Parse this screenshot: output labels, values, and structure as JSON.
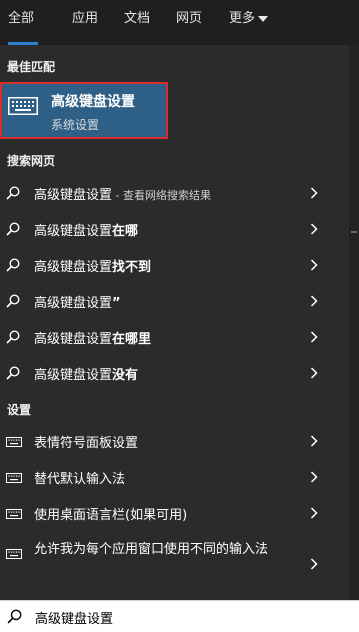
{
  "tabs": [
    {
      "label": "全部",
      "active": true
    },
    {
      "label": "应用"
    },
    {
      "label": "文档"
    },
    {
      "label": "网页"
    },
    {
      "label": "更多"
    }
  ],
  "best_match": {
    "header": "最佳匹配",
    "title": "高级键盘设置",
    "subtitle": "系统设置",
    "icon": "keyboard-icon"
  },
  "web": {
    "header": "搜索网页",
    "items": [
      {
        "prefix": "高级键盘设置",
        "bold": "",
        "suffix": " - 查看网络搜索结果"
      },
      {
        "prefix": "高级键盘设置",
        "bold": "在哪",
        "suffix": ""
      },
      {
        "prefix": "高级键盘设置",
        "bold": "找不到",
        "suffix": ""
      },
      {
        "prefix": "高级键盘设置",
        "bold": "”",
        "suffix": ""
      },
      {
        "prefix": "高级键盘设置",
        "bold": "在哪里",
        "suffix": ""
      },
      {
        "prefix": "高级键盘设置",
        "bold": "没有",
        "suffix": ""
      }
    ]
  },
  "settings": {
    "header": "设置",
    "items": [
      {
        "label": "表情符号面板设置"
      },
      {
        "label": "替代默认输入法"
      },
      {
        "label": "使用桌面语言栏(如果可用)"
      },
      {
        "label": "允许我为每个应用窗口使用不同的输入法"
      }
    ]
  },
  "search": {
    "value": "高级键盘设置",
    "icon": "search-icon"
  },
  "colors": {
    "accent": "#2f7fd1",
    "selection": "#2e5f86",
    "highlight_border": "#d62d2d",
    "background": "#2b2b2b"
  }
}
